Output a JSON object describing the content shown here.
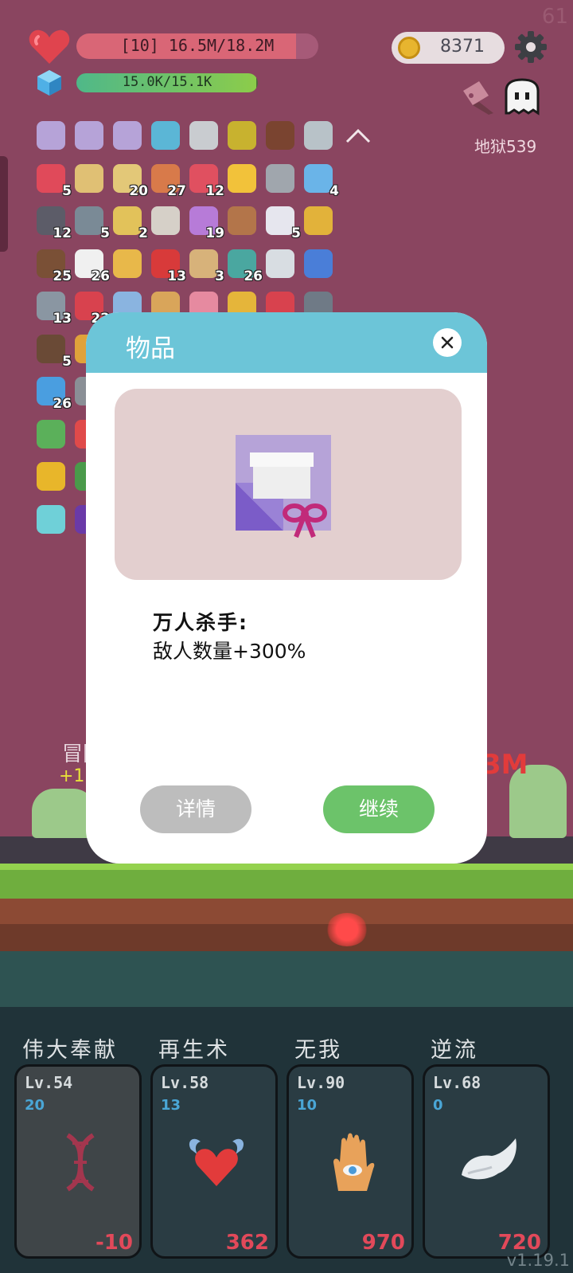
{
  "fps": "61",
  "hud": {
    "hp_text": "[10] 16.5M/18.2M",
    "hp_fraction": 0.907,
    "xp_text": "15.0K/15.1K",
    "xp_fraction": 0.993,
    "coins": "8371",
    "stage": "地狱539"
  },
  "inventory": [
    {
      "icon": "gift-card-icon",
      "color": "#b6a3d8",
      "count": ""
    },
    {
      "icon": "gift-card-icon",
      "color": "#b6a3d8",
      "count": ""
    },
    {
      "icon": "gift-card-icon",
      "color": "#b6a3d8",
      "count": ""
    },
    {
      "icon": "spiral-icon",
      "color": "#5bb6d6",
      "count": ""
    },
    {
      "icon": "safety-pin-icon",
      "color": "#c9ccd0",
      "count": ""
    },
    {
      "icon": "egg-icon",
      "color": "#c8b22f",
      "count": ""
    },
    {
      "icon": "mushroom-icon",
      "color": "#7a4430",
      "count": ""
    },
    {
      "icon": "sword-icon",
      "color": "#b8c2c8",
      "count": ""
    },
    {
      "icon": "strawberry-icon",
      "color": "#e04a5a",
      "count": "5"
    },
    {
      "icon": "scroll-icon",
      "color": "#e0c074",
      "count": ""
    },
    {
      "icon": "map-icon",
      "color": "#e3c878",
      "count": "20"
    },
    {
      "icon": "flag-icon",
      "color": "#d87a4a",
      "count": "27"
    },
    {
      "icon": "watermelon-icon",
      "color": "#e05060",
      "count": "12"
    },
    {
      "icon": "sun-icon",
      "color": "#f2c23a",
      "count": ""
    },
    {
      "icon": "viking-helmet-icon",
      "color": "#a0a6ad",
      "count": ""
    },
    {
      "icon": "syringe-icon",
      "color": "#6ab4e8",
      "count": "4"
    },
    {
      "icon": "bomb-icon",
      "color": "#5c5c68",
      "count": "12"
    },
    {
      "icon": "axe-icon",
      "color": "#7a8a96",
      "count": "5"
    },
    {
      "icon": "ring-icon",
      "color": "#e2c25a",
      "count": "2"
    },
    {
      "icon": "molecule-icon",
      "color": "#d6d0c8",
      "count": ""
    },
    {
      "icon": "flower-pot-icon",
      "color": "#b77bd8",
      "count": "19"
    },
    {
      "icon": "meat-icon",
      "color": "#b3754a",
      "count": ""
    },
    {
      "icon": "envelope-icon",
      "color": "#e6e6ee",
      "count": "5"
    },
    {
      "icon": "pineapple-icon",
      "color": "#e2b23a",
      "count": ""
    },
    {
      "icon": "pirate-ship-icon",
      "color": "#7a5036",
      "count": "25"
    },
    {
      "icon": "ghost-icon",
      "color": "#f0f0f0",
      "count": "26"
    },
    {
      "icon": "beer-icon",
      "color": "#e8b84a",
      "count": ""
    },
    {
      "icon": "apple-icon",
      "color": "#d83a3a",
      "count": "13"
    },
    {
      "icon": "parchment-icon",
      "color": "#d7b27a",
      "count": "3"
    },
    {
      "icon": "ring-target-icon",
      "color": "#4aa7a0",
      "count": "26"
    },
    {
      "icon": "lightbulb-icon",
      "color": "#d8dde2",
      "count": ""
    },
    {
      "icon": "id-card-icon",
      "color": "#4a7ed8",
      "count": ""
    },
    {
      "icon": "sword-icon",
      "color": "#8a96a2",
      "count": "13"
    },
    {
      "icon": "heart-icon",
      "color": "#d8424e",
      "count": "22"
    },
    {
      "icon": "shirt-icon",
      "color": "#8ab4e0",
      "count": ""
    },
    {
      "icon": "briefcase-icon",
      "color": "#d9a55a",
      "count": ""
    },
    {
      "icon": "bottle-icon",
      "color": "#e68aa0",
      "count": ""
    },
    {
      "icon": "coins-icon",
      "color": "#e5b53a",
      "count": ""
    },
    {
      "icon": "sock-icon",
      "color": "#d8424e",
      "count": ""
    },
    {
      "icon": "spiked-ball-icon",
      "color": "#6f7a86",
      "count": ""
    },
    {
      "icon": "coconut-icon",
      "color": "#6a4a36",
      "count": "5"
    },
    {
      "icon": "drink-icon",
      "color": "#e0a23a",
      "count": ""
    },
    {
      "icon": "potion-icon",
      "color": "#4a9ee0",
      "count": "26"
    },
    {
      "icon": "gravestone-icon",
      "color": "#8a8f96",
      "count": ""
    },
    {
      "icon": "tea-cup-icon",
      "color": "#5bb05a",
      "count": ""
    },
    {
      "icon": "book-icon",
      "color": "#e04a4a",
      "count": ""
    },
    {
      "icon": "sunflower-icon",
      "color": "#e8b62a",
      "count": ""
    },
    {
      "icon": "leaf-icon",
      "color": "#4a9a4a",
      "count": ""
    },
    {
      "icon": "frame-icon",
      "color": "#6fd0d8",
      "count": ""
    },
    {
      "icon": "galaxy-icon",
      "color": "#6a3aa8",
      "count": ""
    }
  ],
  "battle": {
    "damage_text": "3M",
    "side_label": "冒险",
    "side_plus": "+15"
  },
  "dialog": {
    "title": "物品",
    "item_icon": "gift-card-icon",
    "item_name": "万人杀手:",
    "item_effect": "敌人数量+300%",
    "detail_button": "详情",
    "continue_button": "继续"
  },
  "skills": [
    {
      "name": "伟大奉献",
      "level": "Lv.54",
      "sub": "20",
      "value": "-10",
      "icon": "dna-icon",
      "dim": true
    },
    {
      "name": "再生术",
      "level": "Lv.58",
      "sub": "13",
      "value": "362",
      "icon": "winged-heart-icon",
      "dim": false
    },
    {
      "name": "无我",
      "level": "Lv.90",
      "sub": "10",
      "value": "970",
      "icon": "eye-hand-icon",
      "dim": false
    },
    {
      "name": "逆流",
      "level": "Lv.68",
      "sub": "0",
      "value": "720",
      "icon": "wing-icon",
      "dim": false
    }
  ],
  "version": "v1.19.1",
  "colors": {
    "background": "#8a4560",
    "dialog_header": "#6cc5d8",
    "continue_button": "#6cc36a",
    "detail_button": "#bdbdbd",
    "skill_value": "#e2495a"
  }
}
